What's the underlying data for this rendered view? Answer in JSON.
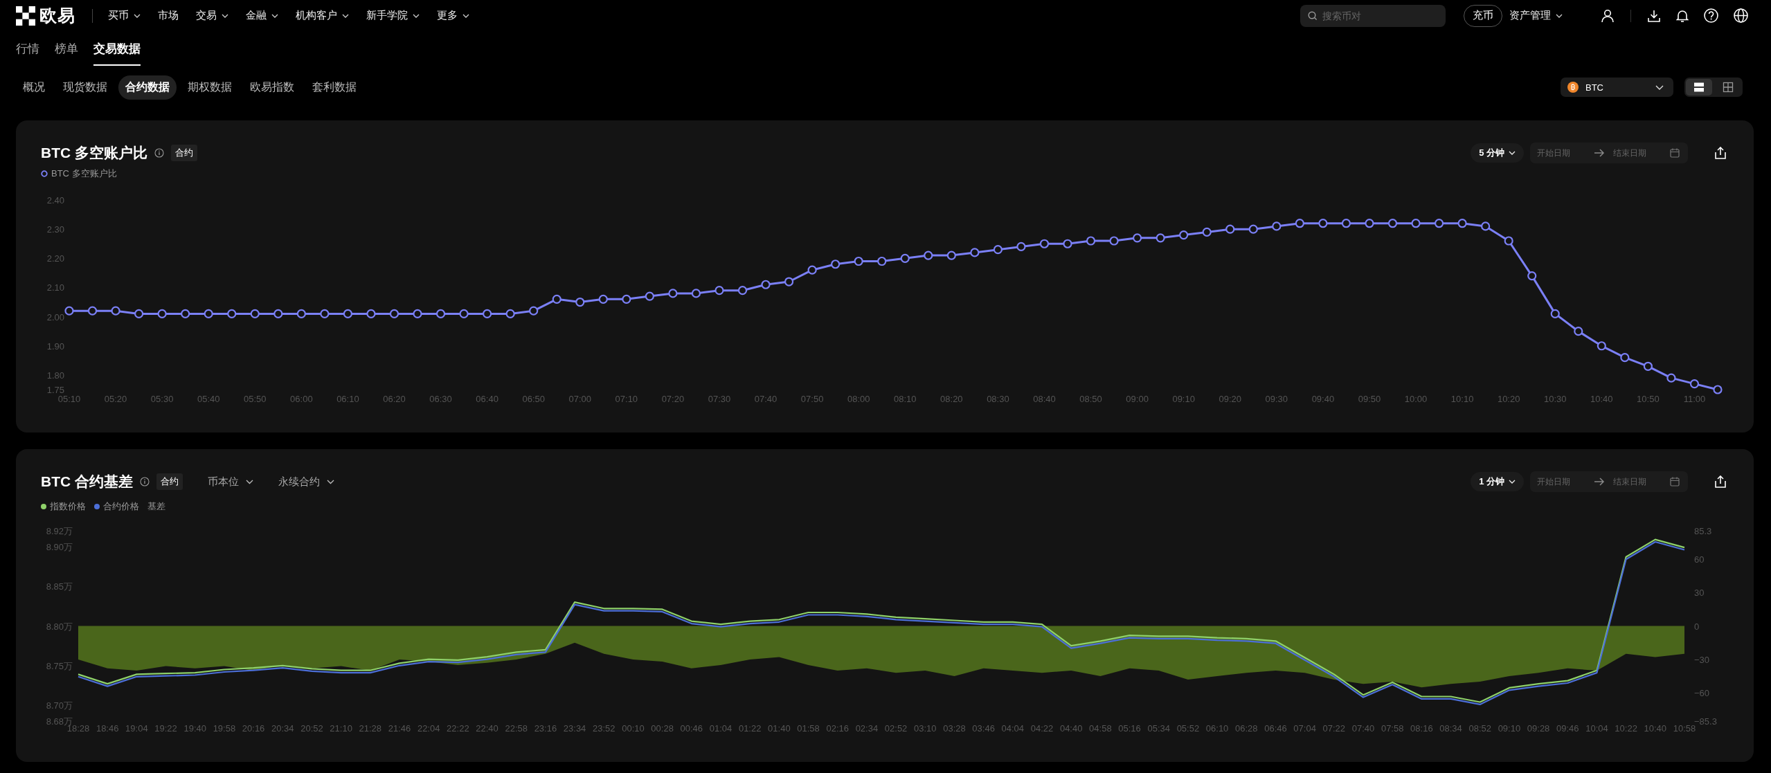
{
  "nav": {
    "logo": "欧易",
    "items": [
      {
        "label": "买币",
        "dropdown": true
      },
      {
        "label": "市场",
        "dropdown": false
      },
      {
        "label": "交易",
        "dropdown": true
      },
      {
        "label": "金融",
        "dropdown": true
      },
      {
        "label": "机构客户",
        "dropdown": true
      },
      {
        "label": "新手学院",
        "dropdown": true
      },
      {
        "label": "更多",
        "dropdown": true
      }
    ],
    "search": {
      "placeholder": "搜索币对"
    },
    "deposit": "充币",
    "assets": "资产管理"
  },
  "tabs": [
    {
      "label": "行情",
      "selected": false
    },
    {
      "label": "榜单",
      "selected": false
    },
    {
      "label": "交易数据",
      "selected": true
    }
  ],
  "categories": [
    {
      "label": "概况",
      "selected": false
    },
    {
      "label": "现货数据",
      "selected": false
    },
    {
      "label": "合约数据",
      "selected": true
    },
    {
      "label": "期权数据",
      "selected": false
    },
    {
      "label": "欧易指数",
      "selected": false
    },
    {
      "label": "套利数据",
      "selected": false
    }
  ],
  "coin_select": {
    "value": "BTC"
  },
  "layout_toggle": [
    {
      "kind": "rows",
      "selected": true
    },
    {
      "kind": "grid",
      "selected": false
    }
  ],
  "panels": [
    {
      "title": "BTC 多空账户比",
      "tag": "合约",
      "interval": "5 分钟",
      "date_start": {
        "placeholder": "开始日期"
      },
      "date_end": {
        "placeholder": "结束日期"
      },
      "chart_data": {
        "type": "line",
        "ylim": [
          1.75,
          2.4
        ],
        "yticks": [
          {
            "value": 2.4,
            "label": "2.40"
          },
          {
            "value": 2.3,
            "label": "2.30"
          },
          {
            "value": 2.2,
            "label": "2.20"
          },
          {
            "value": 2.1,
            "label": "2.10"
          },
          {
            "value": 2.0,
            "label": "2.00"
          },
          {
            "value": 1.9,
            "label": "1.90"
          },
          {
            "value": 1.8,
            "label": "1.80"
          },
          {
            "value": 1.75,
            "label": "1.75"
          }
        ],
        "categories": [
          "05:10",
          null,
          "05:20",
          null,
          "05:30",
          null,
          "05:40",
          null,
          "05:50",
          null,
          "06:00",
          null,
          "06:10",
          null,
          "06:20",
          null,
          "06:30",
          null,
          "06:40",
          null,
          "06:50",
          null,
          "07:00",
          null,
          "07:10",
          null,
          "07:20",
          null,
          "07:30",
          null,
          "07:40",
          null,
          "07:50",
          null,
          "08:00",
          null,
          "08:10",
          null,
          "08:20",
          null,
          "08:30",
          null,
          "08:40",
          null,
          "08:50",
          null,
          "09:00",
          null,
          "09:10",
          null,
          "09:20",
          null,
          "09:30",
          null,
          "09:40",
          null,
          "09:50",
          null,
          "10:00",
          null,
          "10:10",
          null,
          "10:20",
          null,
          "10:30",
          null,
          "10:40",
          null,
          "10:50",
          null,
          "11:00",
          null
        ],
        "series": [
          {
            "name": "BTC 多空账户比",
            "color": "#7b80f7",
            "marker": true,
            "values": [
              2.02,
              2.02,
              2.02,
              2.01,
              2.01,
              2.01,
              2.01,
              2.01,
              2.01,
              2.01,
              2.01,
              2.01,
              2.01,
              2.01,
              2.01,
              2.01,
              2.01,
              2.01,
              2.01,
              2.01,
              2.02,
              2.06,
              2.05,
              2.06,
              2.06,
              2.07,
              2.08,
              2.08,
              2.09,
              2.09,
              2.11,
              2.12,
              2.16,
              2.18,
              2.19,
              2.19,
              2.2,
              2.21,
              2.21,
              2.22,
              2.23,
              2.24,
              2.25,
              2.25,
              2.26,
              2.26,
              2.27,
              2.27,
              2.28,
              2.29,
              2.3,
              2.3,
              2.31,
              2.32,
              2.32,
              2.32,
              2.32,
              2.32,
              2.32,
              2.32,
              2.32,
              2.31,
              2.26,
              2.14,
              2.01,
              1.95,
              1.9,
              1.86,
              1.83,
              1.79,
              1.77,
              1.75
            ]
          }
        ]
      }
    },
    {
      "title": "BTC 合约基差",
      "tag": "合约",
      "filters": [
        "币本位",
        "永续合约"
      ],
      "interval": "1 分钟",
      "date_start": {
        "placeholder": "开始日期"
      },
      "date_end": {
        "placeholder": "结束日期"
      },
      "chart_data": {
        "type": "line",
        "ylim": [
          8.68,
          8.92
        ],
        "yticks": [
          {
            "value": 8.92,
            "label": "8.92万"
          },
          {
            "value": 8.9,
            "label": "8.90万"
          },
          {
            "value": 8.85,
            "label": "8.85万"
          },
          {
            "value": 8.8,
            "label": "8.80万"
          },
          {
            "value": 8.75,
            "label": "8.75万"
          },
          {
            "value": 8.7,
            "label": "8.70万"
          },
          {
            "value": 8.68,
            "label": "8.68万"
          }
        ],
        "y2lim": [
          -85.3,
          85.3
        ],
        "y2ticks": [
          {
            "value": 85.3,
            "label": "85.3"
          },
          {
            "value": 60,
            "label": "60"
          },
          {
            "value": 30,
            "label": "30"
          },
          {
            "value": 0,
            "label": "0"
          },
          {
            "value": -30,
            "label": "−30"
          },
          {
            "value": -60,
            "label": "−60"
          },
          {
            "value": -85.3,
            "label": "−85.3"
          }
        ],
        "categories": [
          "18:28",
          "18:46",
          "19:04",
          "19:22",
          "19:40",
          "19:58",
          "20:16",
          "20:34",
          "20:52",
          "21:10",
          "21:28",
          "21:46",
          "22:04",
          "22:22",
          "22:40",
          "22:58",
          "23:16",
          "23:34",
          "23:52",
          "00:10",
          "00:28",
          "00:46",
          "01:04",
          "01:22",
          "01:40",
          "01:58",
          "02:16",
          "02:34",
          "02:52",
          "03:10",
          "03:28",
          "03:46",
          "04:04",
          "04:22",
          "04:40",
          "04:58",
          "05:16",
          "05:34",
          "05:52",
          "06:10",
          "06:28",
          "06:46",
          "07:04",
          "07:22",
          "07:40",
          "07:58",
          "08:16",
          "08:34",
          "08:52",
          "09:10",
          "09:28",
          "09:46",
          "10:04",
          "10:22",
          "10:40",
          "10:58"
        ],
        "series": [
          {
            "name": "指数价格",
            "color": "#8fd16a",
            "values": [
              8.739,
              8.727,
              8.739,
              8.74,
              8.741,
              8.745,
              8.747,
              8.75,
              8.746,
              8.744,
              8.744,
              8.753,
              8.758,
              8.757,
              8.761,
              8.767,
              8.77,
              8.83,
              8.822,
              8.822,
              8.821,
              8.806,
              8.802,
              8.806,
              8.808,
              8.817,
              8.817,
              8.815,
              8.811,
              8.809,
              8.807,
              8.805,
              8.805,
              8.802,
              8.775,
              8.781,
              8.788,
              8.787,
              8.787,
              8.785,
              8.784,
              8.781,
              8.76,
              8.739,
              8.713,
              8.729,
              8.711,
              8.711,
              8.704,
              8.722,
              8.727,
              8.731,
              8.744,
              8.887,
              8.909,
              8.899
            ]
          },
          {
            "name": "合约价格",
            "color": "#4c6fd8",
            "values": [
              8.736,
              8.724,
              8.736,
              8.737,
              8.738,
              8.742,
              8.744,
              8.747,
              8.743,
              8.741,
              8.741,
              8.75,
              8.755,
              8.754,
              8.758,
              8.764,
              8.767,
              8.827,
              8.819,
              8.819,
              8.818,
              8.803,
              8.799,
              8.803,
              8.805,
              8.814,
              8.814,
              8.812,
              8.808,
              8.806,
              8.804,
              8.802,
              8.802,
              8.799,
              8.772,
              8.778,
              8.785,
              8.784,
              8.784,
              8.782,
              8.781,
              8.778,
              8.757,
              8.736,
              8.71,
              8.726,
              8.708,
              8.708,
              8.701,
              8.719,
              8.724,
              8.728,
              8.741,
              8.884,
              8.906,
              8.896
            ]
          },
          {
            "name": "基差",
            "color": "#4a661b",
            "type": "area",
            "axis": "y2",
            "values": [
              -30,
              -38,
              -40,
              -36,
              -38,
              -36,
              -40,
              -35,
              -38,
              -36,
              -40,
              -30,
              -32,
              -35,
              -33,
              -30,
              -25,
              -15,
              -25,
              -30,
              -32,
              -38,
              -35,
              -30,
              -28,
              -35,
              -40,
              -38,
              -42,
              -40,
              -45,
              -38,
              -40,
              -42,
              -40,
              -45,
              -38,
              -40,
              -48,
              -45,
              -42,
              -40,
              -42,
              -48,
              -52,
              -50,
              -55,
              -52,
              -50,
              -45,
              -42,
              -38,
              -40,
              -25,
              -28,
              -25
            ]
          }
        ]
      }
    }
  ]
}
